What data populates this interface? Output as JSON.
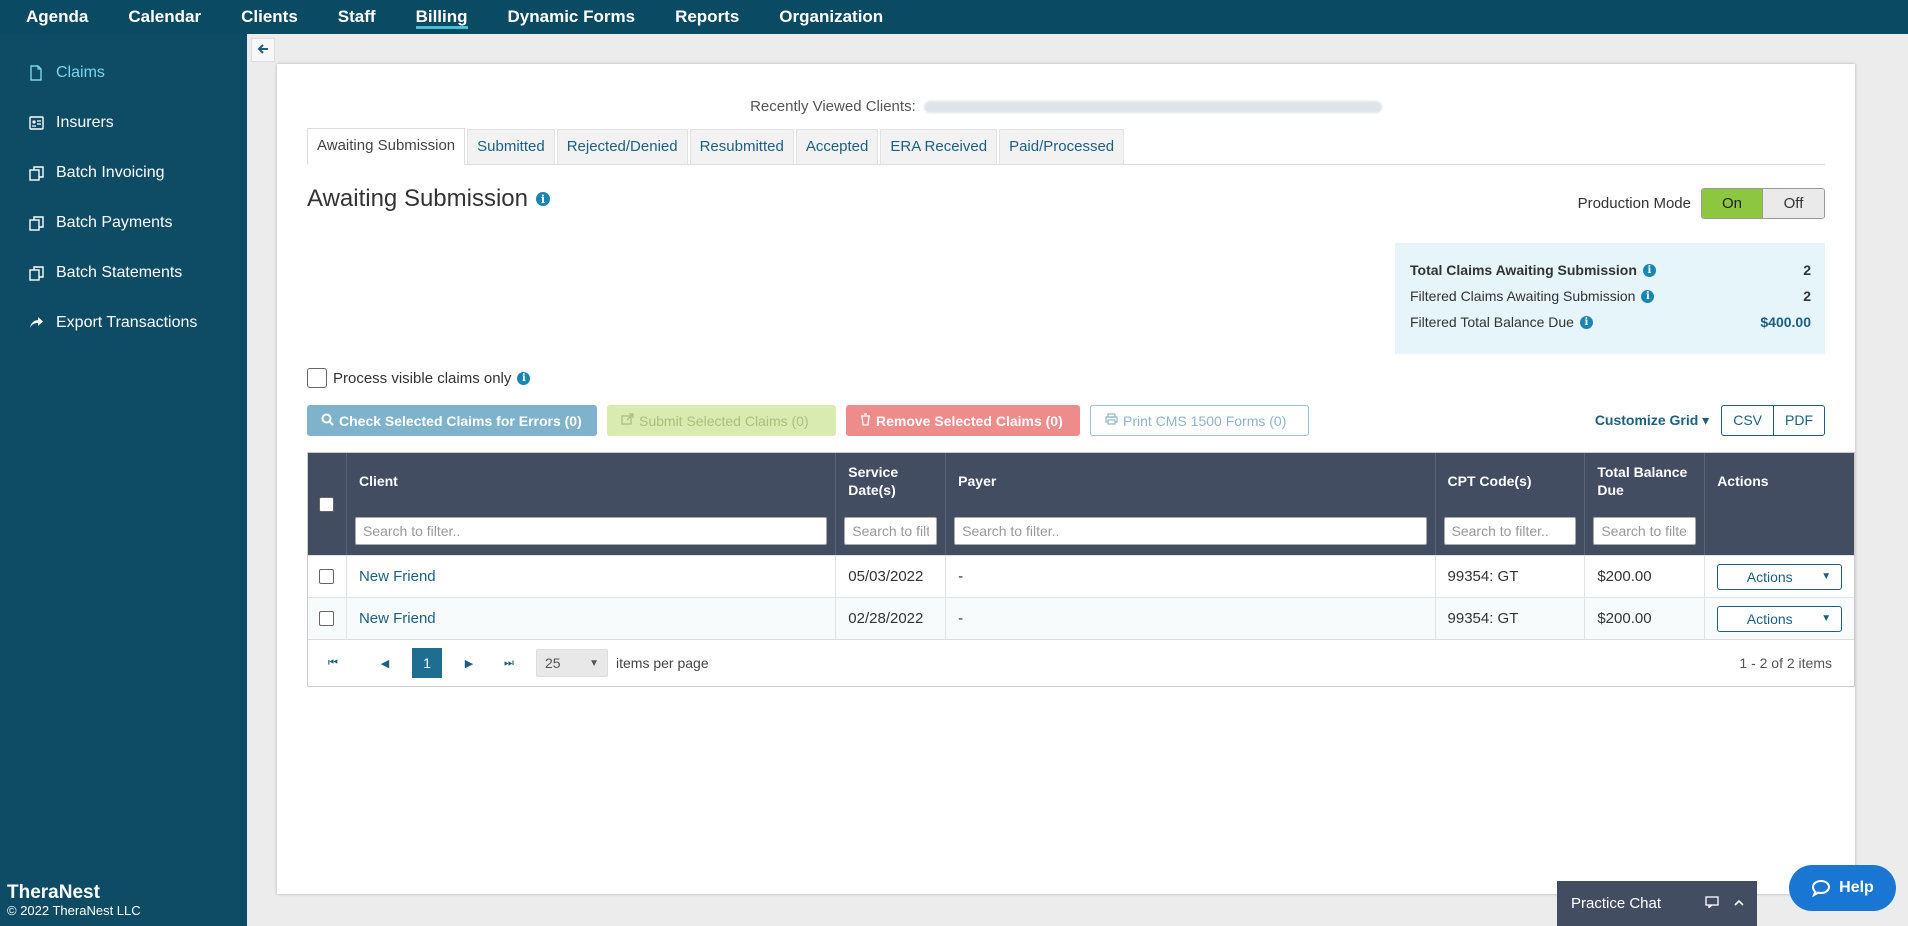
{
  "topnav": {
    "items": [
      {
        "label": "Agenda"
      },
      {
        "label": "Calendar"
      },
      {
        "label": "Clients"
      },
      {
        "label": "Staff"
      },
      {
        "label": "Billing",
        "active": true
      },
      {
        "label": "Dynamic Forms"
      },
      {
        "label": "Reports"
      },
      {
        "label": "Organization"
      }
    ]
  },
  "sidebar": {
    "items": [
      {
        "label": "Claims",
        "icon": "document-icon",
        "active": true
      },
      {
        "label": "Insurers",
        "icon": "id-card-icon"
      },
      {
        "label": "Batch Invoicing",
        "icon": "copy-icon"
      },
      {
        "label": "Batch Payments",
        "icon": "copy-icon"
      },
      {
        "label": "Batch Statements",
        "icon": "copy-icon"
      },
      {
        "label": "Export Transactions",
        "icon": "share-icon"
      }
    ],
    "brand": "TheraNest",
    "copyright": "© 2022 TheraNest LLC"
  },
  "recent": {
    "label": "Recently Viewed Clients:"
  },
  "tabs": [
    {
      "label": "Awaiting Submission",
      "active": true
    },
    {
      "label": "Submitted"
    },
    {
      "label": "Rejected/Denied"
    },
    {
      "label": "Resubmitted"
    },
    {
      "label": "Accepted"
    },
    {
      "label": "ERA Received"
    },
    {
      "label": "Paid/Processed"
    }
  ],
  "page": {
    "title": "Awaiting Submission"
  },
  "production": {
    "label": "Production Mode",
    "on": "On",
    "off": "Off",
    "selected": "On"
  },
  "summary": {
    "total_label": "Total Claims Awaiting Submission",
    "total_value": "2",
    "filtered_label": "Filtered Claims Awaiting Submission",
    "filtered_value": "2",
    "balance_label": "Filtered Total Balance Due",
    "balance_value": "$400.00"
  },
  "process": {
    "label": "Process visible claims only"
  },
  "actions": {
    "check": "Check Selected Claims for Errors (0)",
    "submit": "Submit Selected Claims (0)",
    "remove": "Remove Selected Claims (0)",
    "print": "Print CMS 1500 Forms (0)",
    "customize": "Customize Grid",
    "csv": "CSV",
    "pdf": "PDF"
  },
  "table": {
    "columns": {
      "client": "Client",
      "service_date": "Service Date(s)",
      "payer": "Payer",
      "cpt": "CPT Code(s)",
      "balance": "Total Balance Due",
      "actions": "Actions"
    },
    "filter_placeholder": "Search to filter..",
    "rows": [
      {
        "client": "New Friend",
        "service_date": "05/03/2022",
        "payer": "-",
        "cpt": "99354: GT",
        "balance": "$200.00",
        "action": "Actions"
      },
      {
        "client": "New Friend",
        "service_date": "02/28/2022",
        "payer": "-",
        "cpt": "99354: GT",
        "balance": "$200.00",
        "action": "Actions"
      }
    ]
  },
  "pager": {
    "current": "1",
    "per_page": "25",
    "per_page_label": "items per page",
    "range": "1 - 2 of 2 items"
  },
  "chat": {
    "label": "Practice Chat"
  },
  "help": {
    "label": "Help"
  },
  "colors": {
    "nav": "#0b4a63",
    "sidebar": "#0e4c66",
    "accent": "#1d5f7f",
    "on_toggle": "#8dc63f",
    "table_header": "#424d62"
  }
}
